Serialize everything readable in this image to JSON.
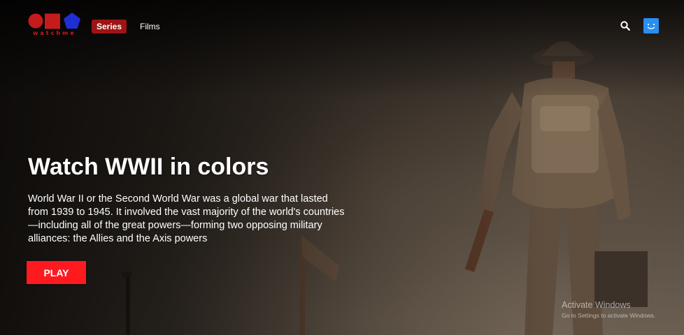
{
  "brand": {
    "logo_text": "watchme",
    "colors": {
      "red": "#c41b1b",
      "blue": "#1f2fd6"
    }
  },
  "nav": {
    "items": [
      {
        "label": "Series",
        "active": true
      },
      {
        "label": "Films",
        "active": false
      }
    ],
    "search_icon": "search-icon",
    "avatar_icon": "smiley-avatar-icon"
  },
  "hero": {
    "title": "Watch WWII in colors",
    "description": "World War II or the Second World War was a global war that lasted from 1939 to 1945. It involved the vast majority of the world's countries—including all of the great powers—forming two opposing military alliances: the Allies and the Axis powers",
    "play_label": "PLAY",
    "accent": "#ff1a1f"
  },
  "watermark": {
    "title": "Activate Windows",
    "subtitle": "Go to Settings to activate Windows."
  }
}
